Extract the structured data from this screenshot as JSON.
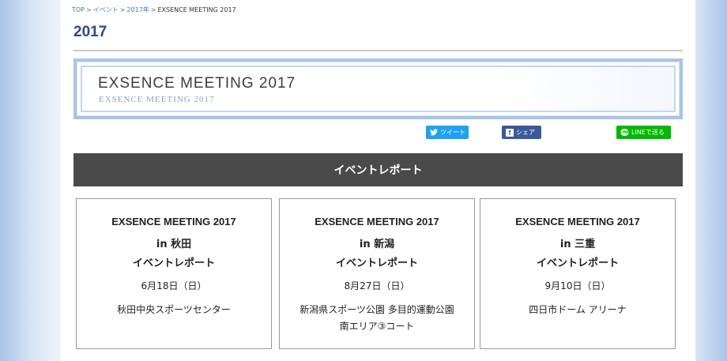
{
  "breadcrumb": {
    "items": [
      "TOP",
      "イベント",
      "2017年"
    ],
    "current": "EXSENCE MEETING 2017",
    "separator": ">"
  },
  "page_title": "2017",
  "banner": {
    "title": "EXSENCE MEETING 2017",
    "subtitle": "EXSENCE MEETING 2017"
  },
  "share": {
    "tweet_label": "ツイート",
    "facebook_label": "シェア",
    "line_label": "LINEで送る",
    "line_icon_text": "LINE"
  },
  "section_title": "イベントレポート",
  "cards": [
    {
      "title": "EXSENCE MEETING 2017",
      "location": "in 秋田",
      "report_label": "イベントレポート",
      "date": "6月18日（日）",
      "venue_line1": "秋田中央スポーツセンター",
      "venue_line2": ""
    },
    {
      "title": "EXSENCE MEETING 2017",
      "location": "in 新潟",
      "report_label": "イベントレポート",
      "date": "8月27日（日）",
      "venue_line1": "新潟県スポーツ公園 多目的運動公園",
      "venue_line2": "南エリア③コート"
    },
    {
      "title": "EXSENCE MEETING 2017",
      "location": "in 三重",
      "report_label": "イベントレポート",
      "date": "9月10日（日）",
      "venue_line1": "四日市ドーム アリーナ",
      "venue_line2": ""
    }
  ],
  "colors": {
    "title_blue": "#2a4a8c",
    "link_blue": "#3a7bbf",
    "twitter": "#1da1f2",
    "facebook": "#3b5998",
    "line": "#00b900",
    "section_bar": "#4a4a4a"
  }
}
